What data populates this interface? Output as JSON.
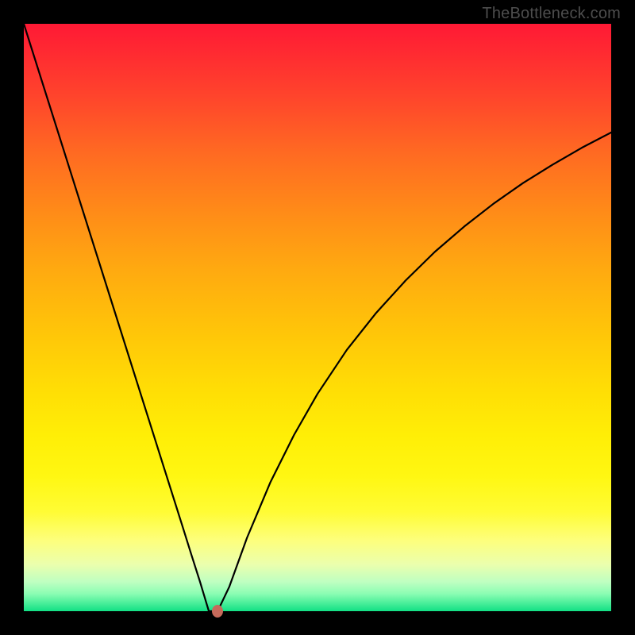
{
  "watermark": "TheBottleneck.com",
  "chart_data": {
    "type": "line",
    "title": "",
    "xlabel": "",
    "ylabel": "",
    "xlim": [
      0,
      100
    ],
    "ylim": [
      0,
      100
    ],
    "series": [
      {
        "name": "bottleneck-curve",
        "x": [
          0,
          3,
          6,
          9,
          12,
          15,
          18,
          21,
          24,
          27,
          28.5,
          30,
          31.5,
          33,
          35,
          38,
          42,
          46,
          50,
          55,
          60,
          65,
          70,
          75,
          80,
          85,
          90,
          95,
          100
        ],
        "y": [
          100,
          90.5,
          81.0,
          71.5,
          62.0,
          52.5,
          43.0,
          33.5,
          24.0,
          14.5,
          9.7,
          5.0,
          0.0,
          0.0,
          4.2,
          12.5,
          22.0,
          30.0,
          37.0,
          44.5,
          50.8,
          56.3,
          61.2,
          65.5,
          69.4,
          72.9,
          76.0,
          78.9,
          81.5
        ]
      }
    ],
    "marker": {
      "x": 33.0,
      "y": 0.0
    },
    "colors": {
      "curve": "#000000",
      "marker": "#c66a5b",
      "background_top": "#ff1935",
      "background_bottom": "#12e085"
    }
  }
}
